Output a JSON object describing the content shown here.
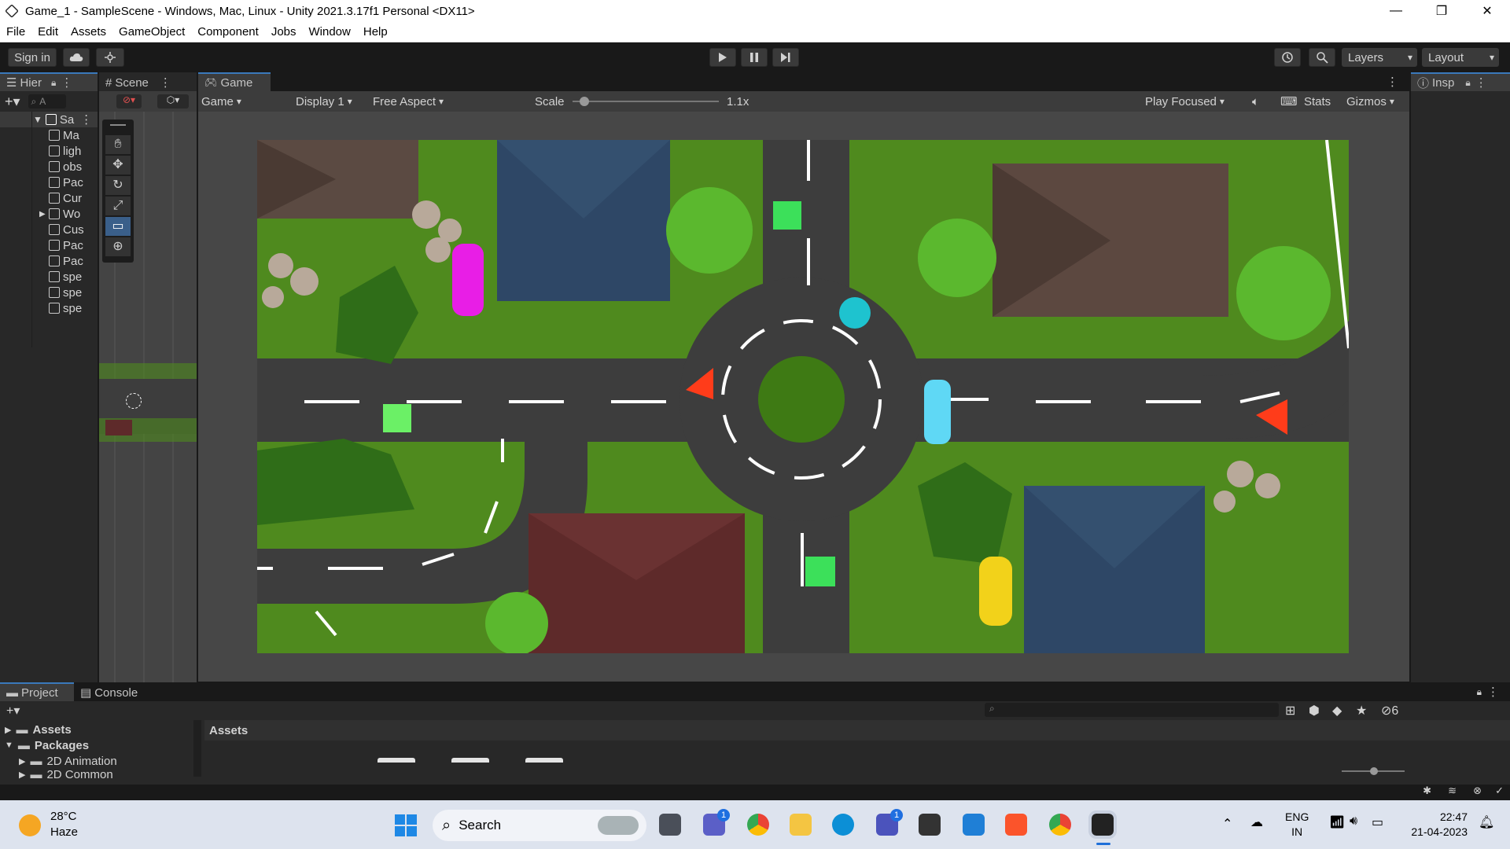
{
  "window": {
    "title": "Game_1 - SampleScene - Windows, Mac, Linux - Unity 2021.3.17f1 Personal <DX11>",
    "minimize": "—",
    "maximize": "❐",
    "close": "✕"
  },
  "menu": [
    "File",
    "Edit",
    "Assets",
    "GameObject",
    "Component",
    "Jobs",
    "Window",
    "Help"
  ],
  "toolbar": {
    "sign_in": "Sign in",
    "cloud_icon": "cloud-icon",
    "collab_icon": "collab-icon",
    "play": "▶",
    "pause": "❚❚",
    "step": "▶|",
    "history_icon": "history-icon",
    "search_icon": "search-icon",
    "layers": "Layers",
    "layout": "Layout"
  },
  "hierarchy": {
    "tab": "Hier",
    "search_placeholder": "A",
    "scene_name": "Sa",
    "items": [
      "Ma",
      "ligh",
      "obs",
      "Pac",
      "Cur",
      "Wo",
      "Cus",
      "Pac",
      "Pac",
      "spe",
      "spe",
      "spe"
    ]
  },
  "scene_tab": {
    "label": "Scene"
  },
  "game": {
    "tab": "Game",
    "mode": "Game",
    "display": "Display 1",
    "aspect": "Free Aspect",
    "scale_label": "Scale",
    "scale_value": "1.1x",
    "scale_fraction": 0.05,
    "play_focused": "Play Focused",
    "stats": "Stats",
    "gizmos": "Gizmos"
  },
  "inspector": {
    "tab": "Insp"
  },
  "bottom": {
    "tab_project": "Project",
    "tab_console": "Console",
    "tree": [
      "Assets",
      "Packages",
      "2D Animation",
      "2D Common"
    ],
    "breadcrumb": "Assets",
    "hidden_count": "6"
  },
  "taskbar": {
    "weather_temp": "28°C",
    "weather_desc": "Haze",
    "search": "Search",
    "lang_top": "ENG",
    "lang_bottom": "IN",
    "time": "22:47",
    "date": "21-04-2023",
    "badge_a": "1",
    "badge_b": "1"
  },
  "colors": {
    "editor_bg": "#191919",
    "panel": "#282828",
    "grass": "#4f8a1e",
    "road": "#3d3d3d",
    "accent": "#3a79bb"
  }
}
